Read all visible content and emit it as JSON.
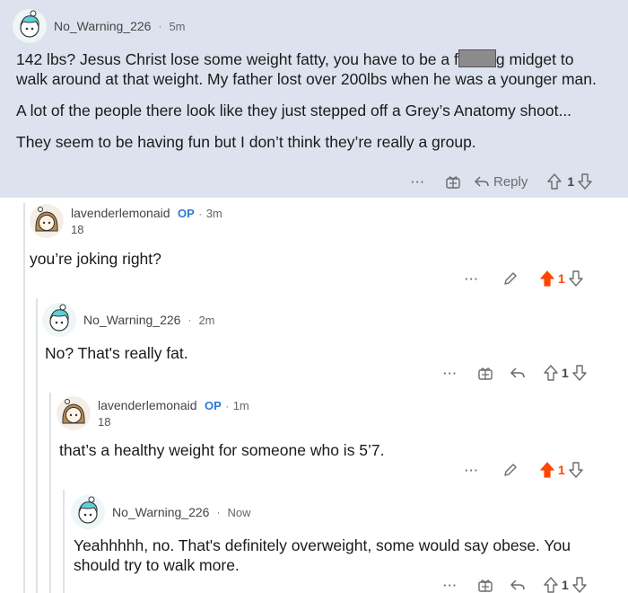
{
  "comments": [
    {
      "username": "No_Warning_226",
      "separator": "·",
      "time": "5m",
      "paragraphs": [
        "142 lbs? Jesus Christ lose some weight fatty, you have to be a f",
        "g midget to walk around at that weight. My father lost over 200lbs when he was a younger man.",
        "A lot of the people there look like they just stepped off a Grey’s Anatomy shoot...",
        "They seem to be having fun but I don’t think they’re really a group."
      ],
      "more": "···",
      "reply_label": "Reply",
      "votes": "1"
    },
    {
      "username": "lavenderlemonaid",
      "op_badge": "OP",
      "separator": "·",
      "time": "3m",
      "flair": "18",
      "text": "you’re joking right?",
      "more": "···",
      "votes": "1"
    },
    {
      "username": "No_Warning_226",
      "separator": "·",
      "time": "2m",
      "text": "No? That's really fat.",
      "more": "···",
      "votes": "1"
    },
    {
      "username": "lavenderlemonaid",
      "op_badge": "OP",
      "separator": "·",
      "time": "1m",
      "flair": "18",
      "text": "that’s a healthy weight for someone who is 5’7.",
      "more": "···",
      "votes": "1"
    },
    {
      "username": "No_Warning_226",
      "separator": "·",
      "time": "Now",
      "text": "Yeahhhhh, no. That's definitely overweight, some would say obese. You should try to walk more.",
      "more": "···",
      "votes": "1"
    }
  ],
  "colors": {
    "highlight_bg": "#dde3ee",
    "upvote_active": "#ff4500",
    "op_blue": "#2b79d6",
    "thread_line": "#dfe1e5"
  }
}
